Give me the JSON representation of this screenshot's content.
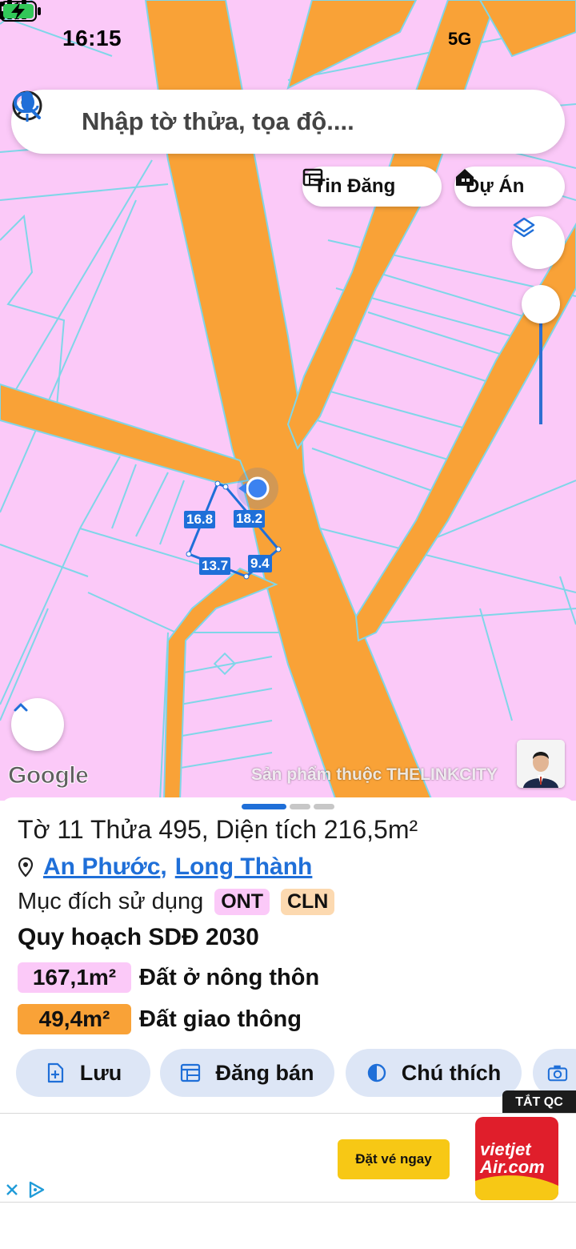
{
  "status": {
    "time": "16:15",
    "network": "5G"
  },
  "search": {
    "placeholder": "Nhập tờ thửa, tọa độ...."
  },
  "chips": {
    "news": "Tin Đăng",
    "project": "Dự Án"
  },
  "map": {
    "edge_labels": [
      "16.8",
      "18.2",
      "13.7",
      "9.4"
    ],
    "google": "Google",
    "watermark": "Sản phẩm thuộc THELINKCITY",
    "colors": {
      "residential": "#fbc9f8",
      "road": "#f9a237",
      "lines": "#7fd6e8",
      "parcel": "#1f6fd8"
    }
  },
  "parcel": {
    "title": "Tờ 11 Thửa 495, Diện tích 216,5m²",
    "ward": "An Phước",
    "separator": ",",
    "district": "Long Thành",
    "purpose_label": "Mục đích sử dụng",
    "purpose_codes": [
      "ONT",
      "CLN"
    ],
    "plan_title": "Quy hoạch SDĐ 2030",
    "zones": [
      {
        "area": "167,1m²",
        "name": "Đất ở nông thôn",
        "color": "#fbc9f8"
      },
      {
        "area": "49,4m²",
        "name": "Đất giao thông",
        "color": "#f9a237"
      }
    ]
  },
  "actions": {
    "save": "Lưu",
    "sell": "Đăng bán",
    "legend": "Chú thích"
  },
  "hide_ads": "TẮT QC",
  "ad": {
    "cta": "Đặt vé ngay",
    "brand": "vietjet Air.com"
  },
  "icons": [
    "location-arrow-icon",
    "signal-icon",
    "battery-charging-icon",
    "account-icon",
    "search-icon",
    "mic-icon",
    "calendar-icon",
    "home-icon",
    "layers-icon",
    "chevron-up-icon",
    "pin-icon",
    "plus-file-icon",
    "list-icon",
    "contrast-icon",
    "camera-icon",
    "close-icon",
    "adchoices-icon"
  ]
}
